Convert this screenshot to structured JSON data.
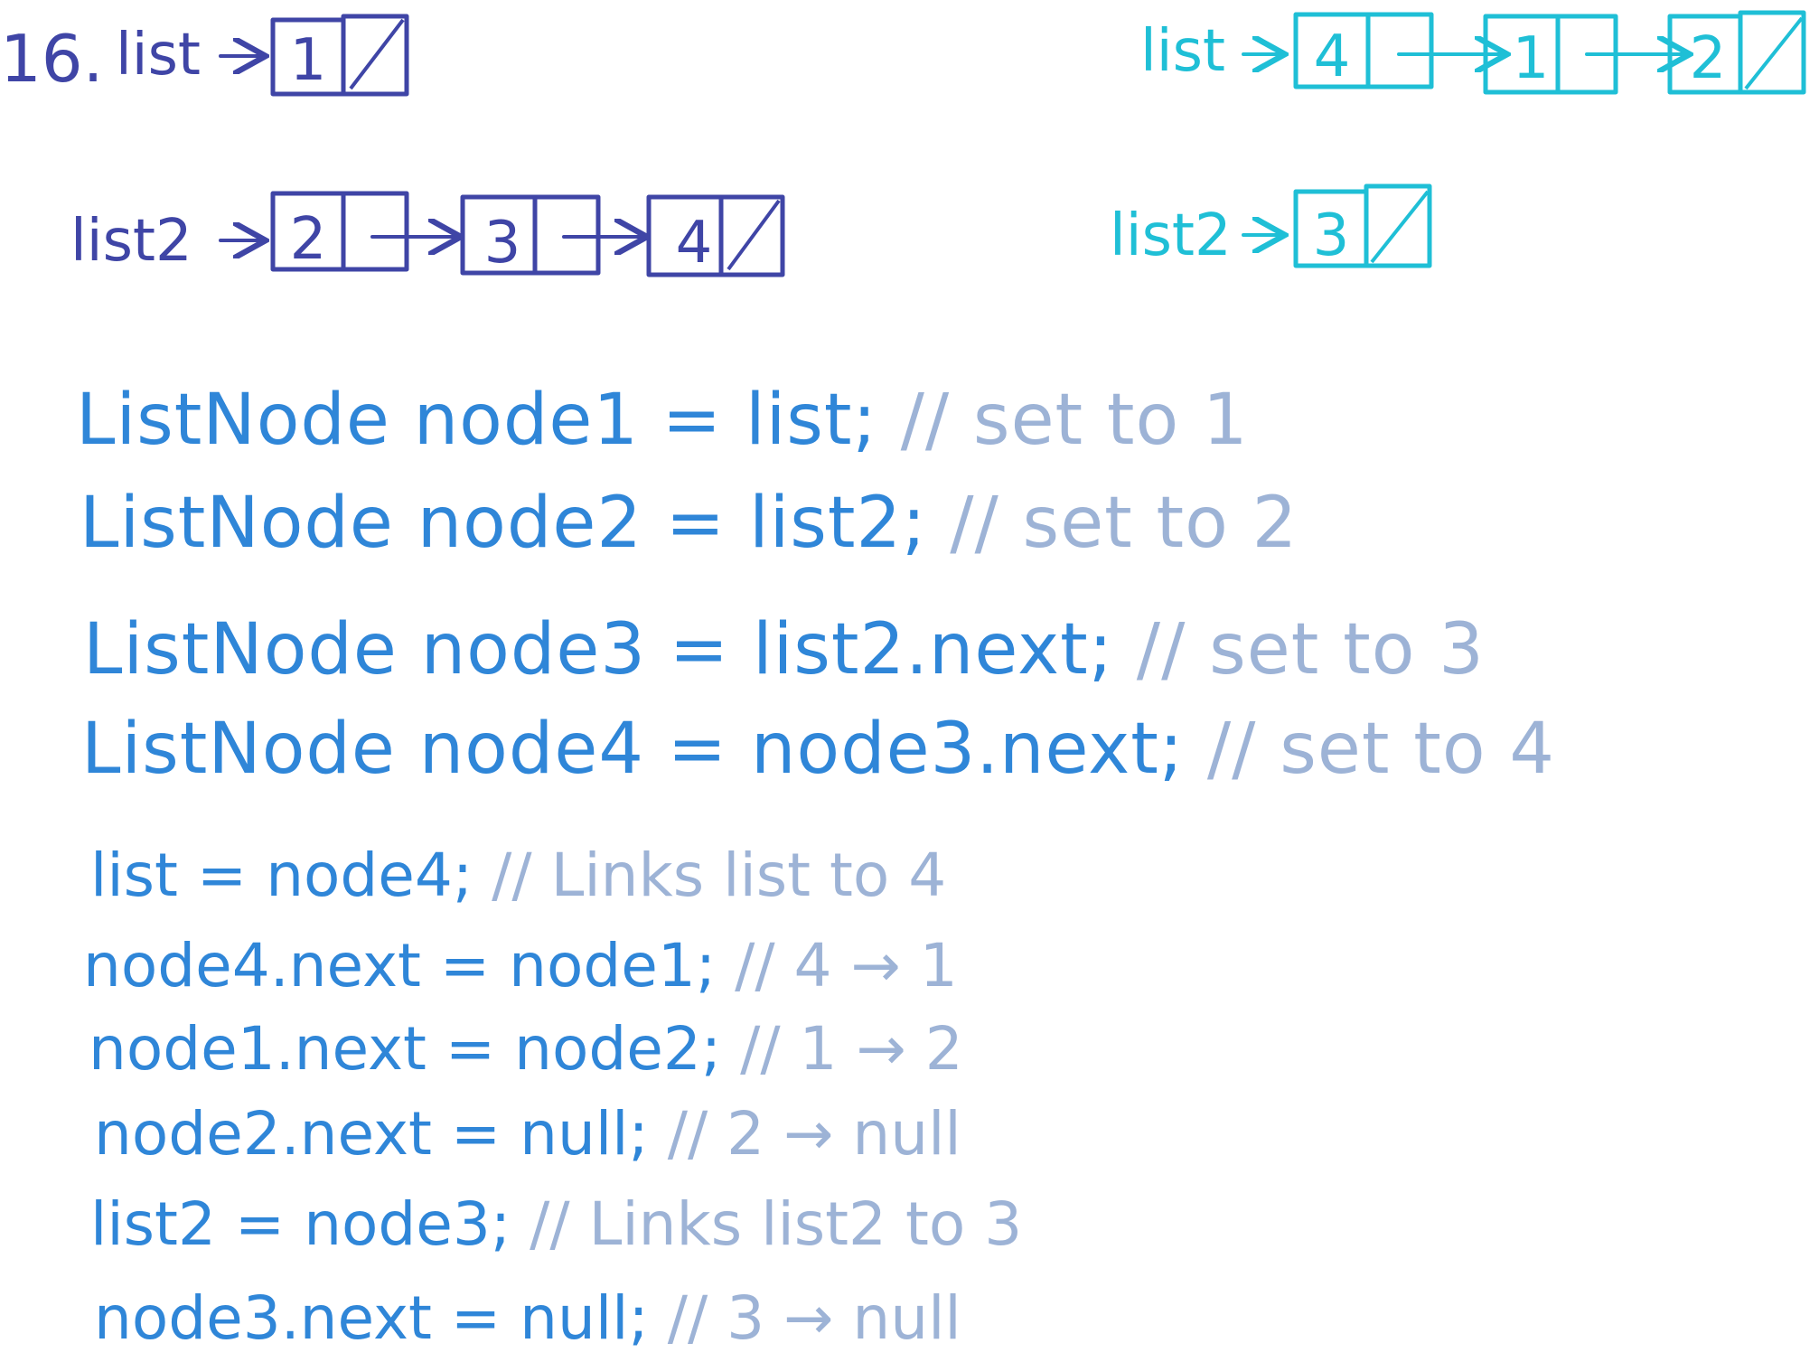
{
  "problem_number": "16.",
  "colors": {
    "before": "#3f45a6",
    "after": "#1fbfd6",
    "code": "#2f86d8",
    "comment": "#9db3d6"
  },
  "before": {
    "list_label": "list",
    "list_nodes": [
      "1"
    ],
    "list2_label": "list2",
    "list2_nodes": [
      "2",
      "3",
      "4"
    ]
  },
  "after": {
    "list_label": "list",
    "list_nodes": [
      "4",
      "1",
      "2"
    ],
    "list2_label": "list2",
    "list2_nodes": [
      "3"
    ]
  },
  "code_lines": [
    {
      "code": "ListNode node1 = list;",
      "comment": "// set to 1"
    },
    {
      "code": "ListNode node2 = list2;",
      "comment": "// set to 2"
    },
    {
      "code": "ListNode node3 = list2.next;",
      "comment": "// set to 3"
    },
    {
      "code": "ListNode node4 = node3.next;",
      "comment": "// set to 4"
    },
    {
      "code": "list = node4;",
      "comment": "// Links list to 4"
    },
    {
      "code": "node4.next = node1;",
      "comment": "// 4 → 1"
    },
    {
      "code": "node1.next = node2;",
      "comment": "// 1 → 2"
    },
    {
      "code": "node2.next = null;",
      "comment": "// 2 → null"
    },
    {
      "code": "list2 = node3;",
      "comment": "// Links list2 to 3"
    },
    {
      "code": "node3.next = null;",
      "comment": "// 3 → null"
    }
  ]
}
